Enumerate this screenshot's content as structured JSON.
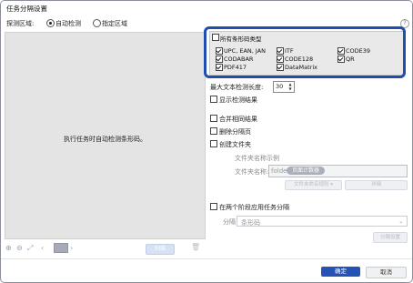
{
  "window": {
    "title": "任务分隔设置",
    "help_icon": "help-icon"
  },
  "detect_area": {
    "label": "探测区域:",
    "options": [
      {
        "label": "自动检测",
        "selected": true
      },
      {
        "label": "指定区域",
        "selected": false
      }
    ]
  },
  "preview": {
    "message": "执行任务时自动检测条形码。"
  },
  "preview_toolbar": {
    "icons": [
      "zoom-in-icon",
      "zoom-out-icon",
      "fit-screen-icon",
      "prev-page-icon",
      "next-page-icon",
      "delete-icon"
    ],
    "scan_label": "扫描"
  },
  "barcodes": {
    "all_label": "所有条形码类型",
    "all_checked": false,
    "items": [
      {
        "label": "UPC, EAN, JAN",
        "checked": true
      },
      {
        "label": "ITF",
        "checked": true
      },
      {
        "label": "CODE39",
        "checked": true
      },
      {
        "label": "CODABAR",
        "checked": true
      },
      {
        "label": "CODE128",
        "checked": true
      },
      {
        "label": "QR",
        "checked": true
      },
      {
        "label": "PDF417",
        "checked": true
      },
      {
        "label": "DataMatrix",
        "checked": true
      }
    ],
    "highlight_color": "#1f4eb0"
  },
  "max_text_length": {
    "label": "最大文本检测长度:",
    "value": "30"
  },
  "options": {
    "show_results": {
      "label": "显示检测结果",
      "checked": false
    },
    "merge_same": {
      "label": "合并相同结果",
      "checked": false
    },
    "delete_separator": {
      "label": "删除分隔页",
      "checked": false
    },
    "create_folder": {
      "label": "创建文件夹",
      "checked": false
    }
  },
  "folder": {
    "example_label": "文件夹名称示例",
    "name_label": "文件夹名称:",
    "prefix": "folder",
    "chip": "页面计数器",
    "naming_button": "文件夹命名规则",
    "detail_button": "详细"
  },
  "split": {
    "label": "在两个阶段应用任务分隔",
    "checked": false,
    "split_label": "分隔",
    "select_value": "条形码",
    "settings_button": "分隔设置"
  },
  "footer": {
    "ok": "确定",
    "cancel": "取消"
  }
}
